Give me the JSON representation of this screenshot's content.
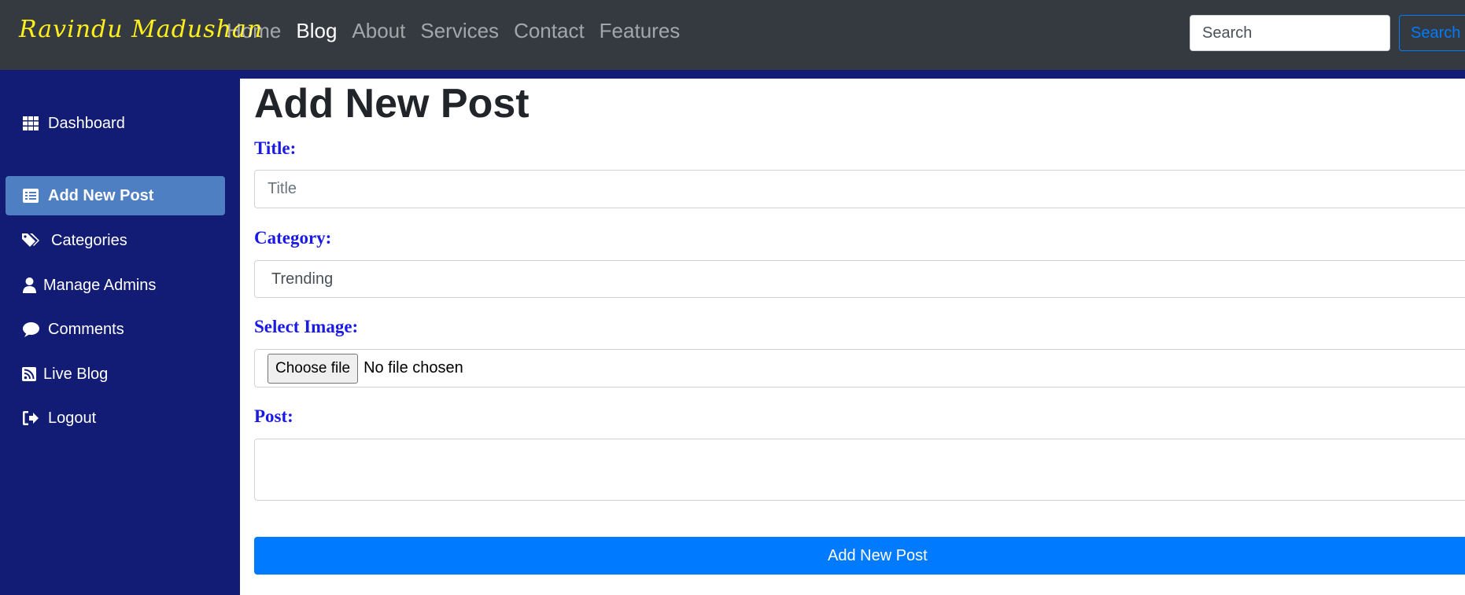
{
  "navbar": {
    "brand": "Ravindu Madushan",
    "links": [
      "Home",
      "Blog",
      "About",
      "Services",
      "Contact",
      "Features"
    ],
    "active_link": "Blog",
    "search_placeholder": "Search",
    "search_button": "Search"
  },
  "sidebar": {
    "items": [
      {
        "label": "Dashboard",
        "icon": "grid-icon"
      },
      {
        "label": "Add New Post",
        "icon": "list-icon",
        "active": true
      },
      {
        "label": "Categories",
        "icon": "tags-icon"
      },
      {
        "label": "Manage Admins",
        "icon": "user-icon"
      },
      {
        "label": "Comments",
        "icon": "comment-icon"
      },
      {
        "label": "Live Blog",
        "icon": "rss-icon"
      },
      {
        "label": "Logout",
        "icon": "sign-out-icon"
      }
    ]
  },
  "main": {
    "title": "Add New Post",
    "title_label": "Title:",
    "title_placeholder": "Title",
    "category_label": "Category:",
    "category_selected": "Trending",
    "image_label": "Select Image:",
    "file_button": "Choose file",
    "file_status": "No file chosen",
    "post_label": "Post:",
    "submit_button": "Add New Post"
  },
  "colors": {
    "navbar_bg": "#343a40",
    "sidebar_bg": "#121c74",
    "sidebar_active": "#4f7fc3",
    "brand": "#ffef1a",
    "label": "#1a1ae6",
    "primary": "#007bff"
  }
}
